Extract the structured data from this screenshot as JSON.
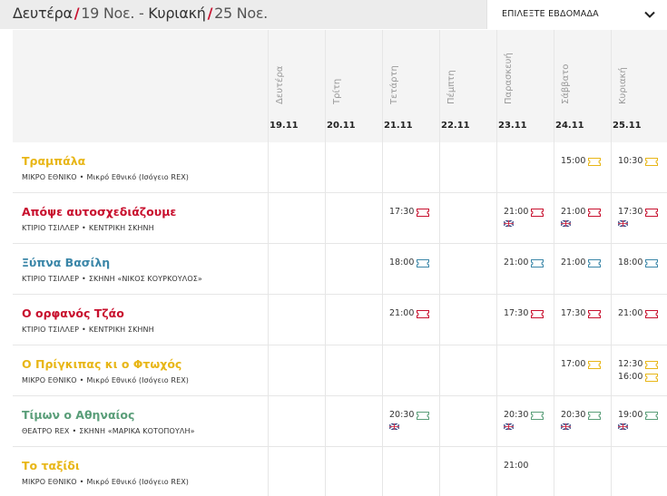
{
  "header": {
    "start_day": "Δευτέρα",
    "start_date": "19 Νοε.",
    "sep": "-",
    "end_day": "Κυριακή",
    "end_date": "25 Νοε.",
    "week_select_label": "ΕΠΙΛΕΞΤΕ ΕΒΔΟΜΑΔΑ"
  },
  "days": [
    {
      "name": "Δευτέρα",
      "date": "19.11"
    },
    {
      "name": "Τρίτη",
      "date": "20.11"
    },
    {
      "name": "Τετάρτη",
      "date": "21.11"
    },
    {
      "name": "Πέμπτη",
      "date": "22.11"
    },
    {
      "name": "Παρασκευή",
      "date": "23.11"
    },
    {
      "name": "Σάββατο",
      "date": "24.11"
    },
    {
      "name": "Κυριακή",
      "date": "25.11"
    }
  ],
  "colors": {
    "yellow": "#e8b617",
    "red": "#c8102e",
    "blue": "#3a86a8",
    "green": "#5a9e79"
  },
  "shows": [
    {
      "title": "Τραμπάλα",
      "venue_a": "ΜΙΚΡΟ ΕΘΝΙΚΟ",
      "venue_b": "Μικρό Εθνικό (Ισόγειο REX)",
      "color": "yellow",
      "slots": [
        {
          "day": 5,
          "time": "15:00",
          "ticket": true
        },
        {
          "day": 6,
          "time": "10:30",
          "ticket": true
        }
      ]
    },
    {
      "title": "Απόψε αυτοσχεδιάζουμε",
      "venue_a": "ΚΤΙΡΙΟ ΤΣΙΛΛΕΡ",
      "venue_b": "ΚΕΝΤΡΙΚΗ ΣΚΗΝΗ",
      "color": "red",
      "slots": [
        {
          "day": 2,
          "time": "17:30",
          "ticket": true
        },
        {
          "day": 4,
          "time": "21:00",
          "ticket": true,
          "flag": true
        },
        {
          "day": 5,
          "time": "21:00",
          "ticket": true,
          "flag": true
        },
        {
          "day": 6,
          "time": "17:30",
          "ticket": true,
          "flag": true
        }
      ]
    },
    {
      "title": "Ξύπνα Βασίλη",
      "venue_a": "ΚΤΙΡΙΟ ΤΣΙΛΛΕΡ",
      "venue_b": "ΣΚΗΝΗ «ΝΙΚΟΣ ΚΟΥΡΚΟΥΛΟΣ»",
      "color": "blue",
      "slots": [
        {
          "day": 2,
          "time": "18:00",
          "ticket": true
        },
        {
          "day": 4,
          "time": "21:00",
          "ticket": true
        },
        {
          "day": 5,
          "time": "21:00",
          "ticket": true
        },
        {
          "day": 6,
          "time": "18:00",
          "ticket": true
        }
      ]
    },
    {
      "title": "Ο ορφανός Τζάο",
      "venue_a": "ΚΤΙΡΙΟ ΤΣΙΛΛΕΡ",
      "venue_b": "ΚΕΝΤΡΙΚΗ ΣΚΗΝΗ",
      "color": "red",
      "slots": [
        {
          "day": 2,
          "time": "21:00",
          "ticket": true
        },
        {
          "day": 4,
          "time": "17:30",
          "ticket": true
        },
        {
          "day": 5,
          "time": "17:30",
          "ticket": true
        },
        {
          "day": 6,
          "time": "21:00",
          "ticket": true
        }
      ]
    },
    {
      "title": "Ο Πρίγκιπας κι ο Φτωχός",
      "venue_a": "ΜΙΚΡΟ ΕΘΝΙΚΟ",
      "venue_b": "Μικρό Εθνικό (Ισόγειο REX)",
      "color": "yellow",
      "slots": [
        {
          "day": 5,
          "time": "17:00",
          "ticket": true
        },
        {
          "day": 6,
          "time": "12:30",
          "ticket": true
        },
        {
          "day": 6,
          "time": "16:00",
          "ticket": true,
          "second": true
        }
      ]
    },
    {
      "title": "Τίμων ο Αθηναίος",
      "venue_a": "ΘΕΑΤΡΟ REX",
      "venue_b": "ΣΚΗΝΗ «ΜΑΡΙΚΑ ΚΟΤΟΠΟΥΛΗ»",
      "color": "green",
      "slots": [
        {
          "day": 2,
          "time": "20:30",
          "ticket": true,
          "flag": true
        },
        {
          "day": 4,
          "time": "20:30",
          "ticket": true,
          "flag": true
        },
        {
          "day": 5,
          "time": "20:30",
          "ticket": true,
          "flag": true
        },
        {
          "day": 6,
          "time": "19:00",
          "ticket": true,
          "flag": true
        }
      ]
    },
    {
      "title": "Το ταξίδι",
      "venue_a": "ΜΙΚΡΟ ΕΘΝΙΚΟ",
      "venue_b": "Μικρό Εθνικό (Ισόγειο REX)",
      "color": "yellow",
      "slots": [
        {
          "day": 4,
          "time": "21:00",
          "ticket": false
        }
      ]
    }
  ]
}
